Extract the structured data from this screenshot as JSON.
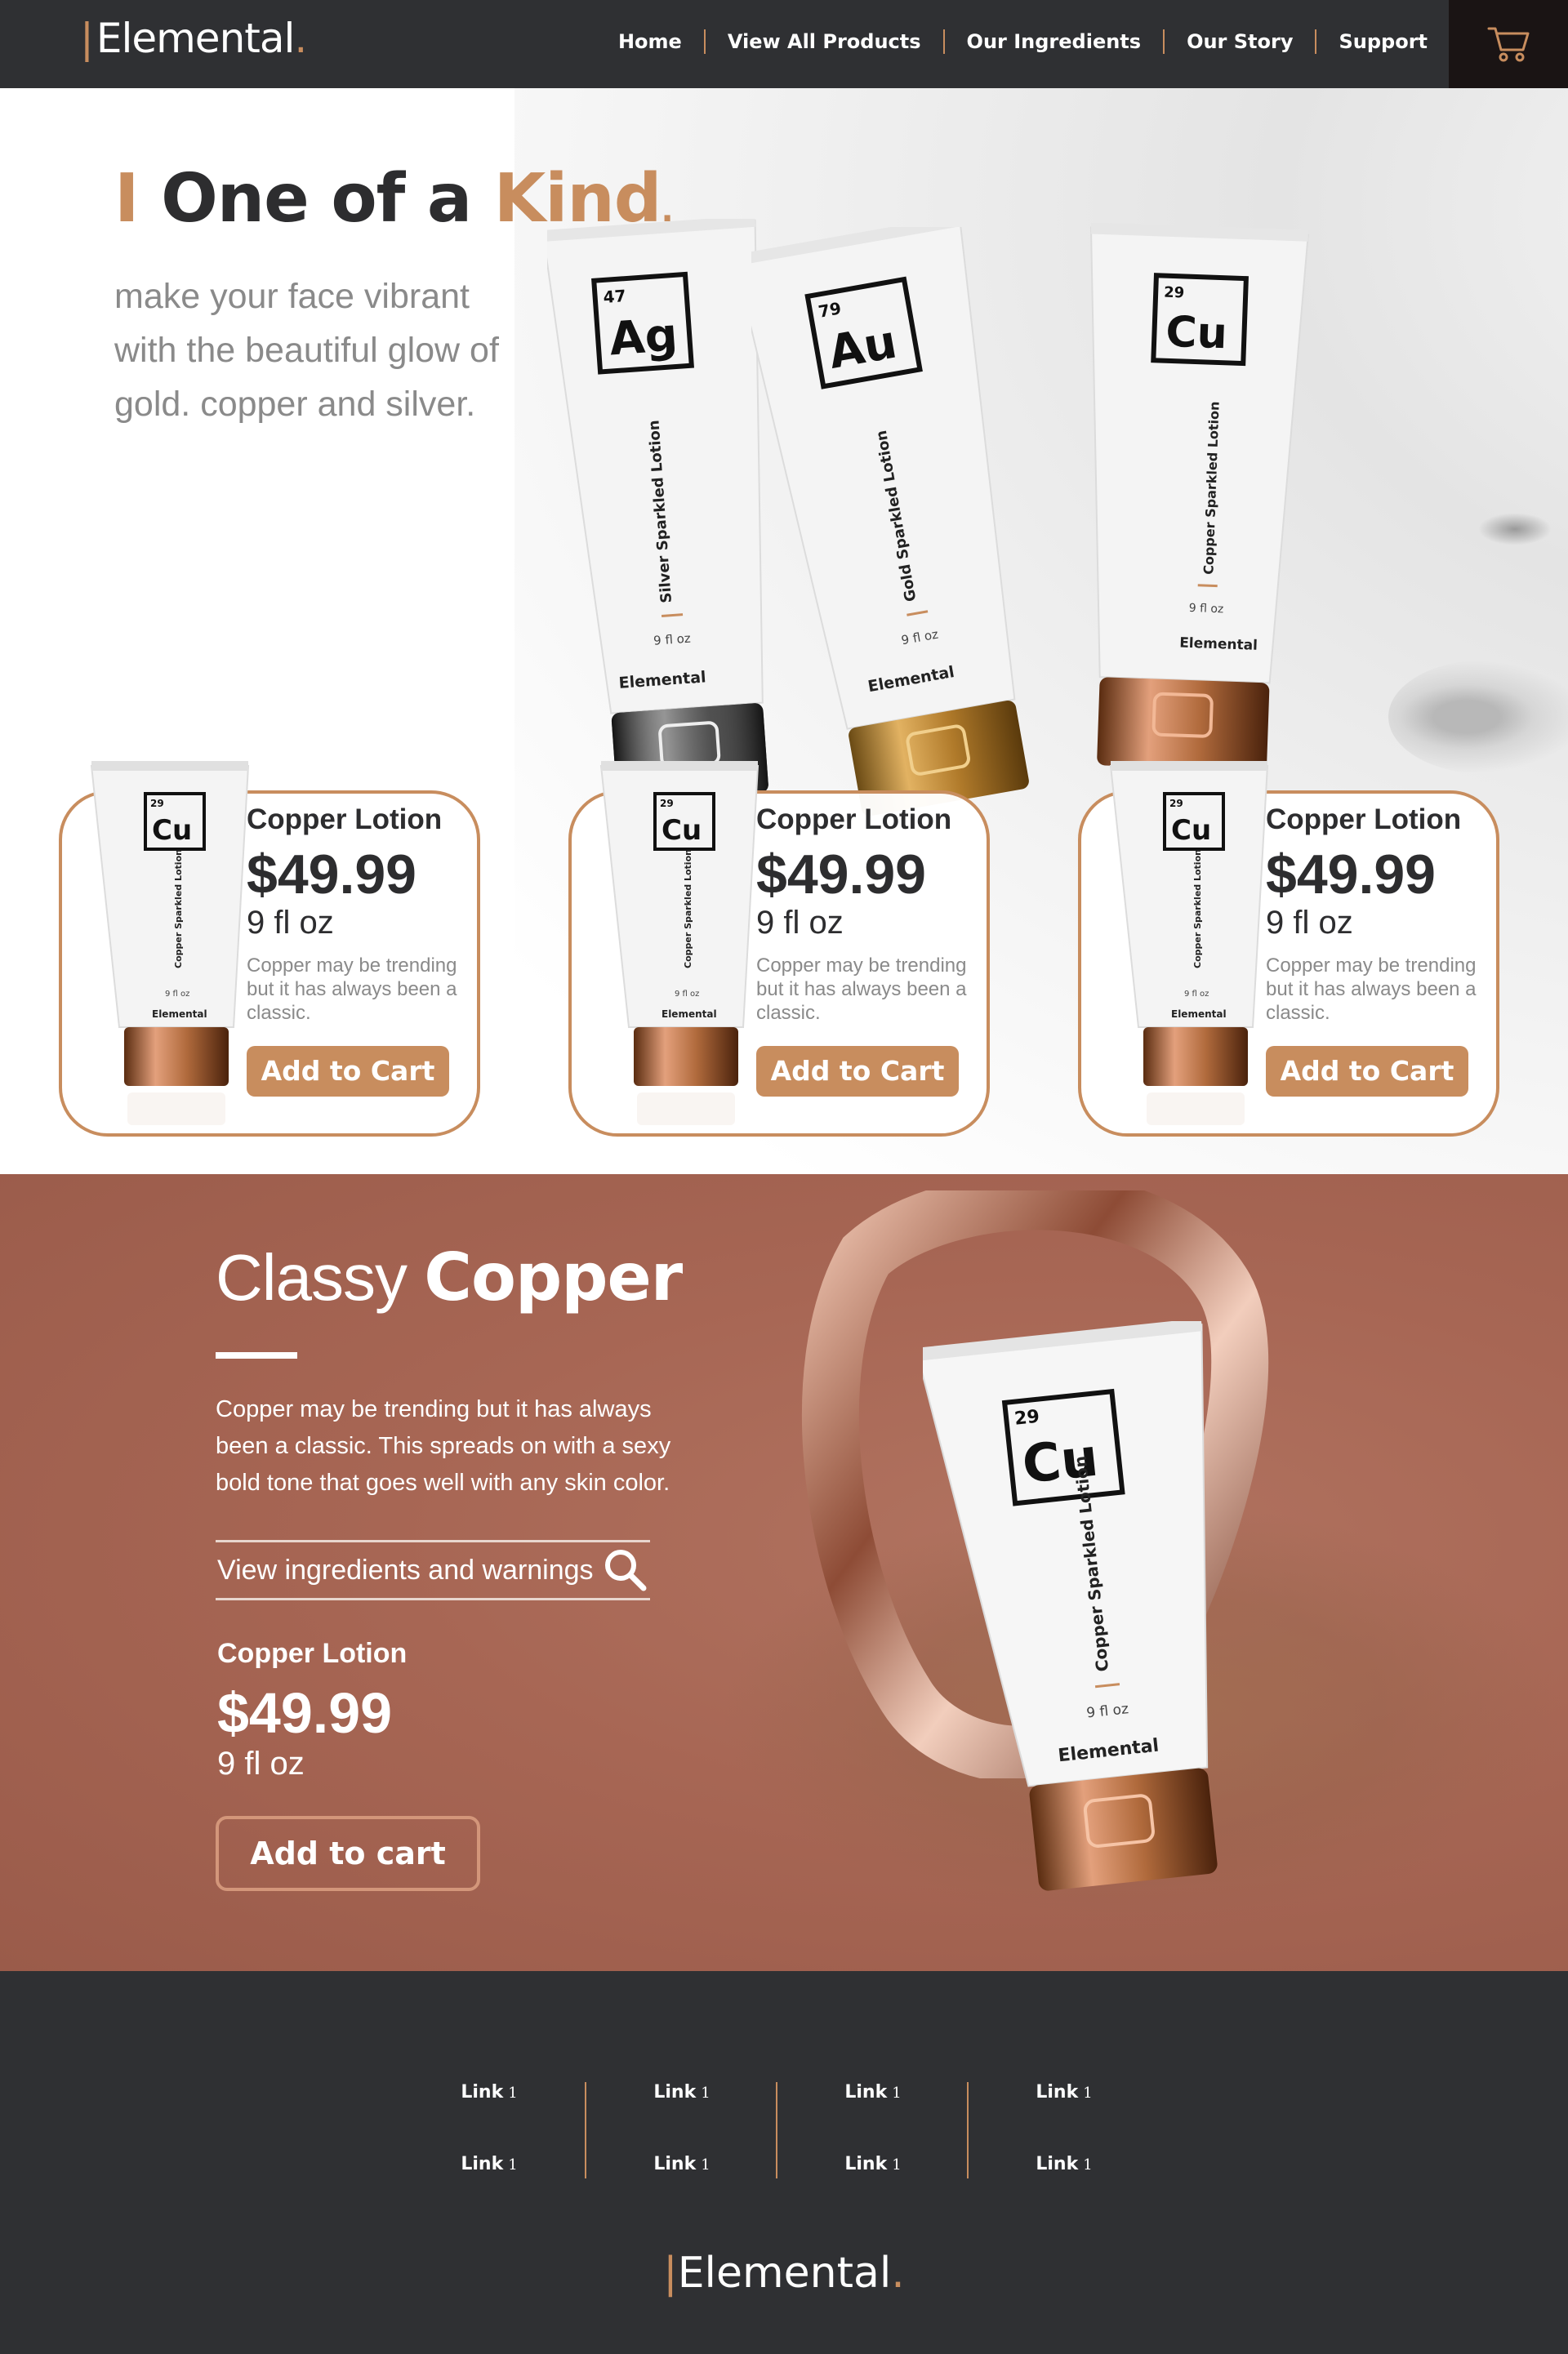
{
  "brand": {
    "name": "Elemental",
    "accent": "#c88d5e",
    "dark": "#2f3033"
  },
  "nav": {
    "links": [
      "Home",
      "View All Products",
      "Our Ingredients",
      "Our Story",
      "Support"
    ],
    "cart_icon": "cart-icon"
  },
  "hero": {
    "headline_pre": "I",
    "headline_main": "One of a ",
    "headline_accent": "Kind",
    "subhead": "make your face vibrant with the beautiful glow of gold. copper and silver.",
    "tubes": [
      {
        "symbol": "Ag",
        "number": "47",
        "name": "Silver Sparkled Lotion",
        "size": "9 fl oz",
        "brand": "Elemental",
        "cap": "silver"
      },
      {
        "symbol": "Au",
        "number": "79",
        "name": "Gold Sparkled Lotion",
        "size": "9 fl oz",
        "brand": "Elemental",
        "cap": "gold"
      },
      {
        "symbol": "Cu",
        "number": "29",
        "name": "Copper Sparkled Lotion",
        "size": "9 fl oz",
        "brand": "Elemental",
        "cap": "copper"
      }
    ]
  },
  "cards": [
    {
      "title": "Copper Lotion",
      "price": "$49.99",
      "size": "9 fl oz",
      "desc": "Copper may be trending but it has always been a classic.",
      "button": "Add to Cart"
    },
    {
      "title": "Copper Lotion",
      "price": "$49.99",
      "size": "9 fl oz",
      "desc": "Copper may be trending but it has always been a classic.",
      "button": "Add to Cart"
    },
    {
      "title": "Copper Lotion",
      "price": "$49.99",
      "size": "9 fl oz",
      "desc": "Copper may be trending but it has always been a classic.",
      "button": "Add to Cart"
    }
  ],
  "card_tube": {
    "symbol": "Cu",
    "number": "29",
    "name": "Copper Sparkled Lotion",
    "size": "9 fl oz",
    "brand": "Elemental"
  },
  "feature": {
    "title_light": "Classy ",
    "title_bold": "Copper",
    "description": "Copper may be trending but it has always been a classic. This spreads on with a sexy bold tone that goes well with any skin color.",
    "ingredients_link": "View ingredients and warnings",
    "product_name": "Copper Lotion",
    "price": "$49.99",
    "size": "9 fl oz",
    "button": "Add to cart",
    "tube": {
      "symbol": "Cu",
      "number": "29",
      "name": "Copper Sparkled Lotion",
      "size": "9 fl oz",
      "brand": "Elemental"
    }
  },
  "footer": {
    "columns": [
      [
        {
          "label": "Link",
          "num": "1"
        },
        {
          "label": "Link",
          "num": "1"
        }
      ],
      [
        {
          "label": "Link",
          "num": "1"
        },
        {
          "label": "Link",
          "num": "1"
        }
      ],
      [
        {
          "label": "Link",
          "num": "1"
        },
        {
          "label": "Link",
          "num": "1"
        }
      ],
      [
        {
          "label": "Link",
          "num": "1"
        },
        {
          "label": "Link",
          "num": "1"
        }
      ]
    ],
    "logo": "Elemental"
  }
}
